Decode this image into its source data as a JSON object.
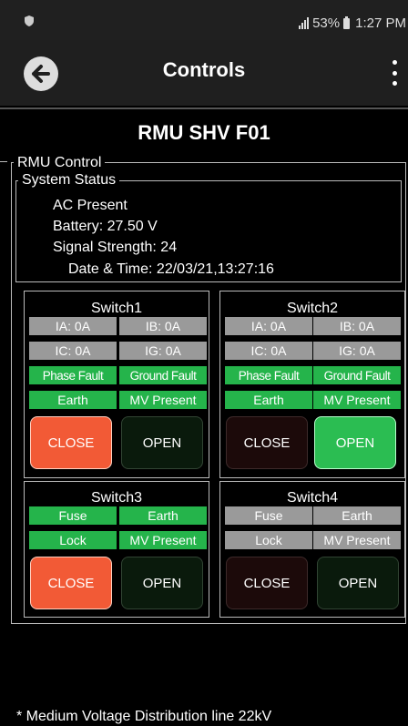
{
  "status_bar": {
    "signal_icon": "signal-icon",
    "battery_percent": "53%",
    "time": "1:27 PM",
    "left_icon": "shield-icon"
  },
  "app_bar": {
    "title": "Controls",
    "back_icon": "back-arrow-icon",
    "menu_icon": "more-vertical-icon"
  },
  "device": {
    "title": "RMU SHV F01"
  },
  "rmu_control": {
    "legend": "RMU Control",
    "system_status": {
      "legend": "System Status",
      "lines": [
        "AC Present",
        "Battery: 27.50 V",
        "Signal Strength: 24",
        "Date & Time: 22/03/21,13:27:16"
      ]
    },
    "switches": [
      {
        "title": "Switch1",
        "cells": [
          "IA: 0A",
          "IB: 0A",
          "IC: 0A",
          "IG: 0A",
          "Phase Fault",
          "Ground Fault",
          "Earth",
          "MV Present"
        ],
        "close_label": "CLOSE",
        "open_label": "OPEN"
      },
      {
        "title": "Switch2",
        "cells": [
          "IA: 0A",
          "IB: 0A",
          "IC: 0A",
          "IG: 0A",
          "Phase Fault",
          "Ground Fault",
          "Earth",
          "MV Present"
        ],
        "close_label": "CLOSE",
        "open_label": "OPEN"
      },
      {
        "title": "Switch3",
        "cells": [
          "Fuse",
          "Earth",
          "Lock",
          "MV Present"
        ],
        "close_label": "CLOSE",
        "open_label": "OPEN"
      },
      {
        "title": "Switch4",
        "cells": [
          "Fuse",
          "Earth",
          "Lock",
          "MV Present"
        ],
        "close_label": "CLOSE",
        "open_label": "OPEN"
      }
    ]
  },
  "footnote": "* Medium Voltage Distribution line 22kV",
  "colors": {
    "green_indicator": "#25b44b",
    "grey_indicator": "#9a9a9a",
    "close_active": "#f25a36",
    "open_active": "#2bbd52"
  }
}
